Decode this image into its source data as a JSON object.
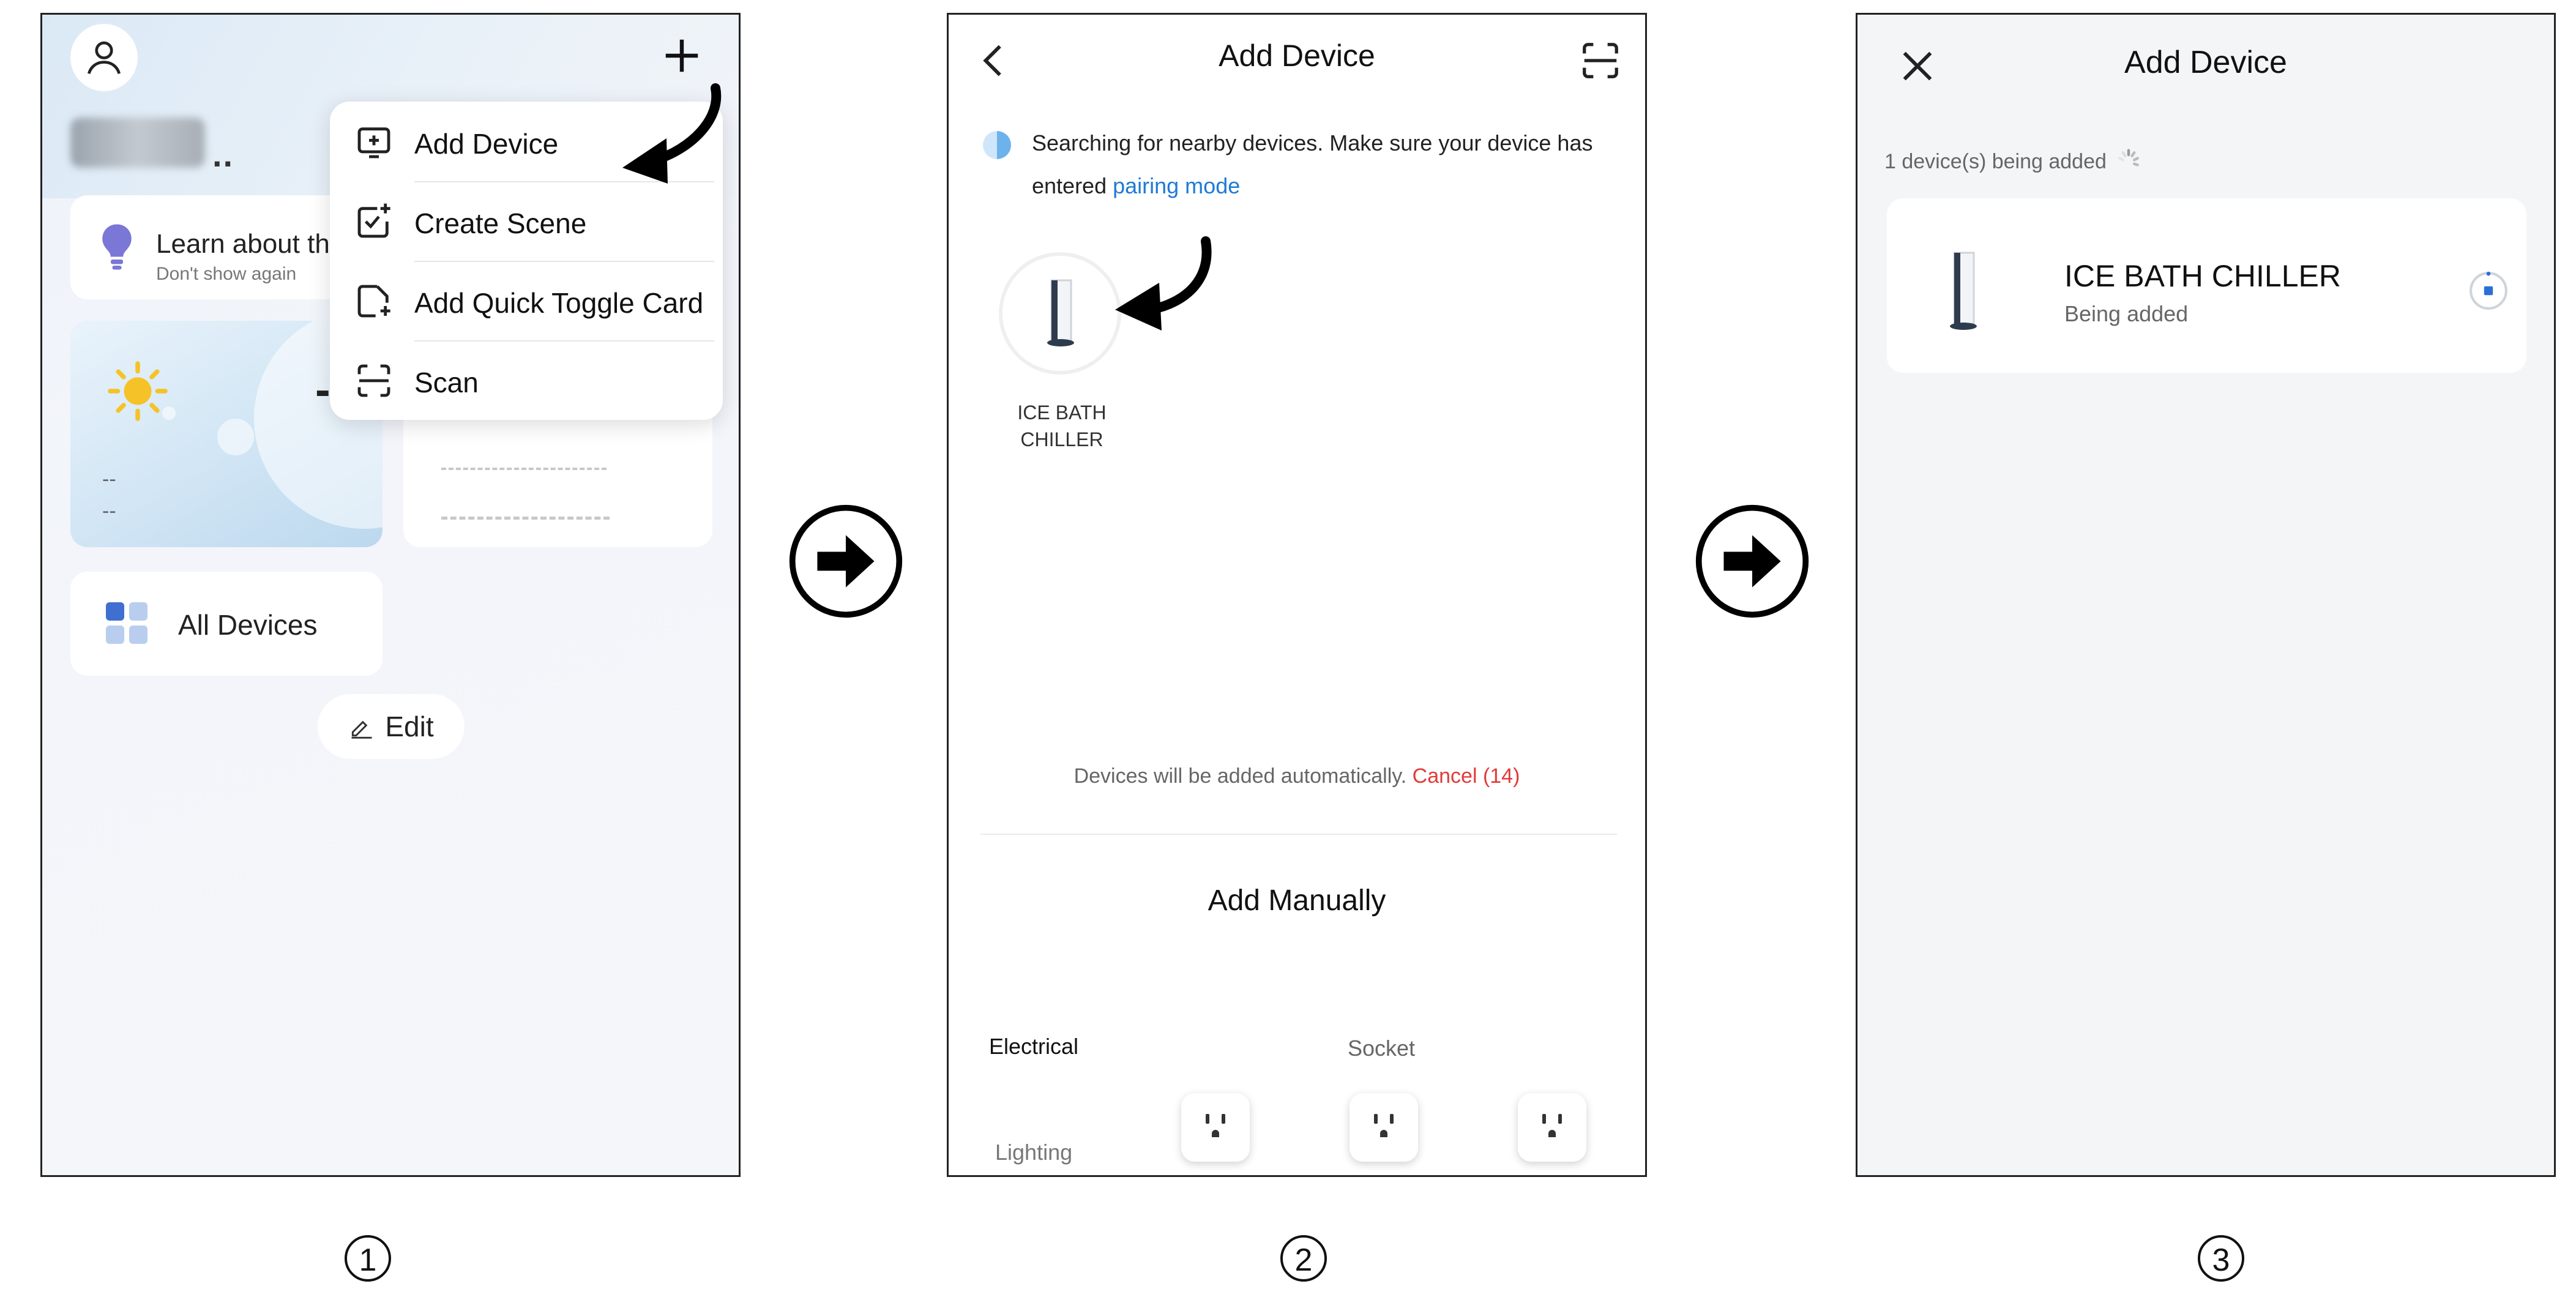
{
  "panel1": {
    "home_name_suffix": "..",
    "learn_card": {
      "title": "Learn about th",
      "subtitle": "Don't show again"
    },
    "weather": {
      "temp": "--",
      "line1": "--",
      "line2": "--"
    },
    "all_devices_label": "All Devices",
    "edit_label": "Edit",
    "menu": {
      "items": [
        {
          "label": "Add Device",
          "icon": "add-device-icon"
        },
        {
          "label": "Create Scene",
          "icon": "create-scene-icon"
        },
        {
          "label": "Add Quick Toggle Card",
          "icon": "add-card-icon"
        },
        {
          "label": "Scan",
          "icon": "scan-icon"
        }
      ]
    }
  },
  "panel2": {
    "title": "Add Device",
    "search_text": "Searching for nearby devices. Make sure your device has entered ",
    "pairing_link": "pairing mode",
    "found_device": {
      "line1": "ICE  BATH",
      "line2": "CHILLER"
    },
    "auto_text": "Devices will be added automatically. ",
    "cancel_label": "Cancel (14)",
    "add_manually": "Add Manually",
    "categories": {
      "electrical": "Electrical",
      "lighting": "Lighting",
      "socket": "Socket"
    }
  },
  "panel3": {
    "title": "Add Device",
    "count_text": "1 device(s) being added",
    "device_name": "ICE  BATH CHILLER",
    "device_status": "Being added"
  },
  "steps": {
    "one": "1",
    "two": "2",
    "three": "3"
  },
  "colors": {
    "link_blue": "#1e7ad6",
    "cancel_red": "#e23a3a",
    "bulb_purple": "#7b77d6",
    "sun_yellow": "#f5c228"
  }
}
